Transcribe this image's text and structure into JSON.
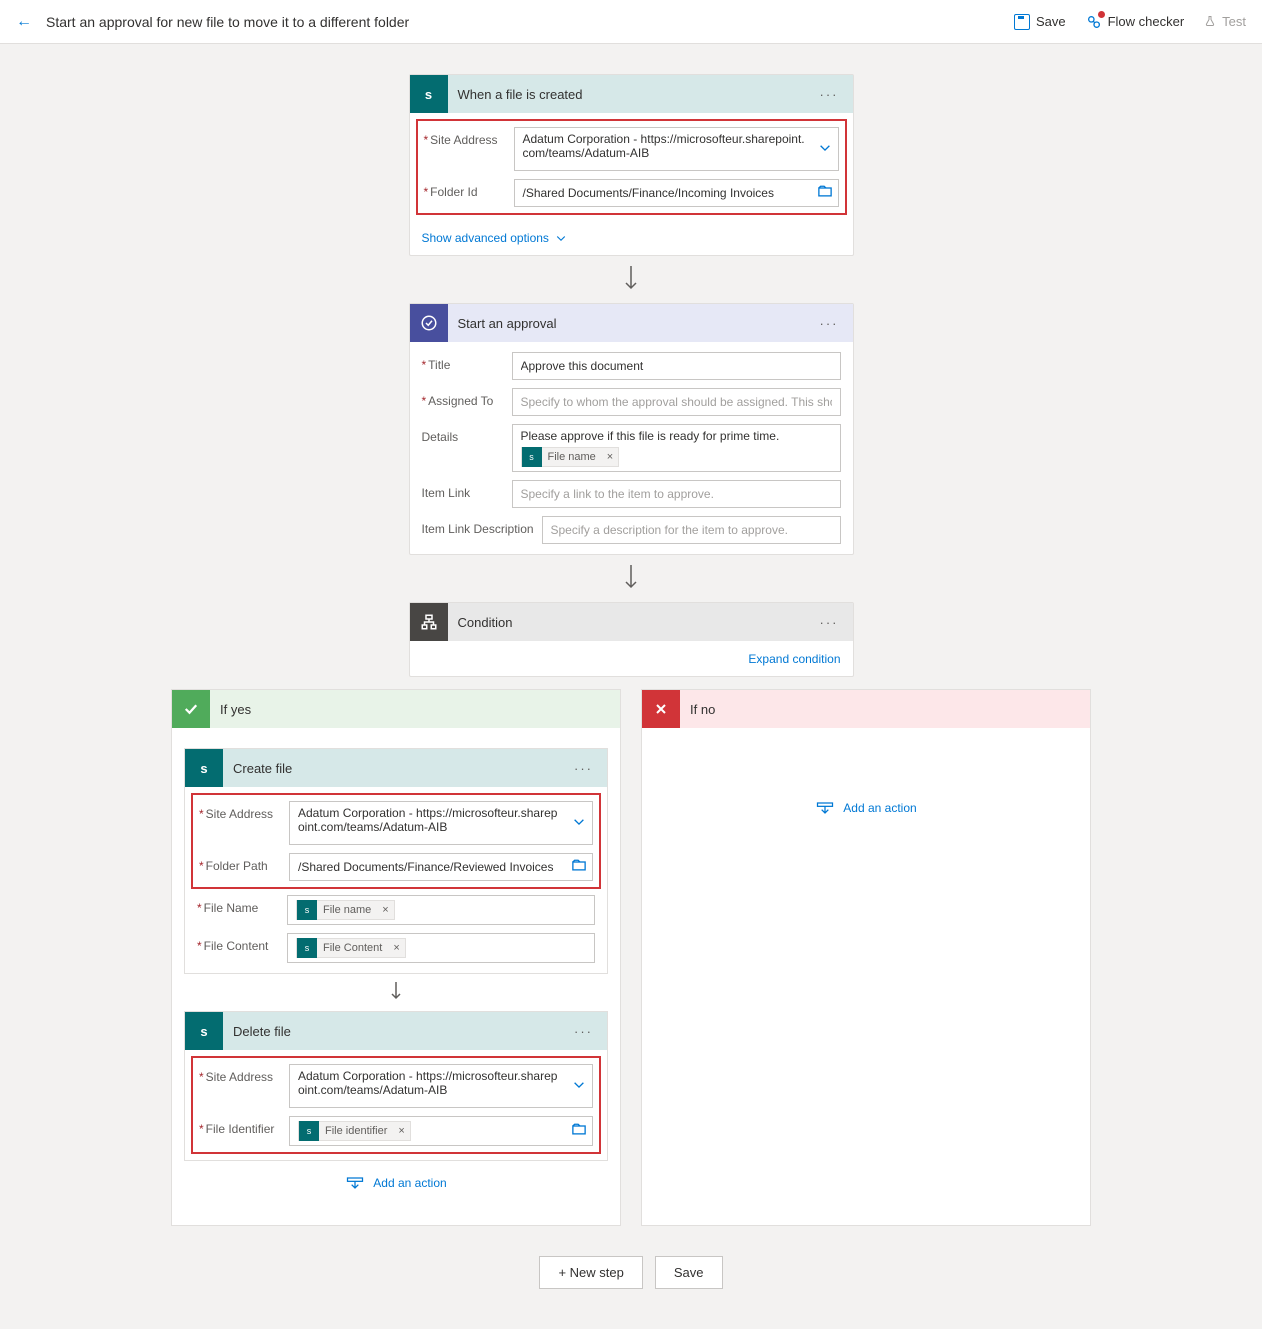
{
  "header": {
    "title": "Start an approval for new file to move it to a different folder",
    "save": "Save",
    "flow_checker": "Flow checker",
    "test": "Test"
  },
  "trigger": {
    "title": "When a file is created",
    "site_label": "Site Address",
    "site_value": "Adatum Corporation - https://microsofteur.sharepoint.com/teams/Adatum-AIB",
    "folder_label": "Folder Id",
    "folder_value": "/Shared Documents/Finance/Incoming Invoices",
    "advanced": "Show advanced options"
  },
  "approval": {
    "title": "Start an approval",
    "title_label": "Title",
    "title_value": "Approve this document",
    "assigned_label": "Assigned To",
    "assigned_placeholder": "Specify to whom the approval should be assigned. This should be a s",
    "details_label": "Details",
    "details_text": "Please approve if this file is ready for prime time.",
    "details_token": "File name",
    "link_label": "Item Link",
    "link_placeholder": "Specify a link to the item to approve.",
    "linkdesc_label": "Item Link Description",
    "linkdesc_placeholder": "Specify a description for the item to approve."
  },
  "condition": {
    "title": "Condition",
    "expand": "Expand condition"
  },
  "yes": {
    "title": "If yes",
    "create": {
      "title": "Create file",
      "site_label": "Site Address",
      "site_value": "Adatum Corporation - https://microsofteur.sharepoint.com/teams/Adatum-AIB",
      "folder_label": "Folder Path",
      "folder_value": "/Shared Documents/Finance/Reviewed Invoices",
      "filename_label": "File Name",
      "filename_token": "File name",
      "filecontent_label": "File Content",
      "filecontent_token": "File Content"
    },
    "delete": {
      "title": "Delete file",
      "site_label": "Site Address",
      "site_value": "Adatum Corporation - https://microsofteur.sharepoint.com/teams/Adatum-AIB",
      "fileid_label": "File Identifier",
      "fileid_token": "File identifier"
    },
    "add_action": "Add an action"
  },
  "no": {
    "title": "If no",
    "add_action": "Add an action"
  },
  "footer": {
    "new_step": "+ New step",
    "save": "Save"
  }
}
